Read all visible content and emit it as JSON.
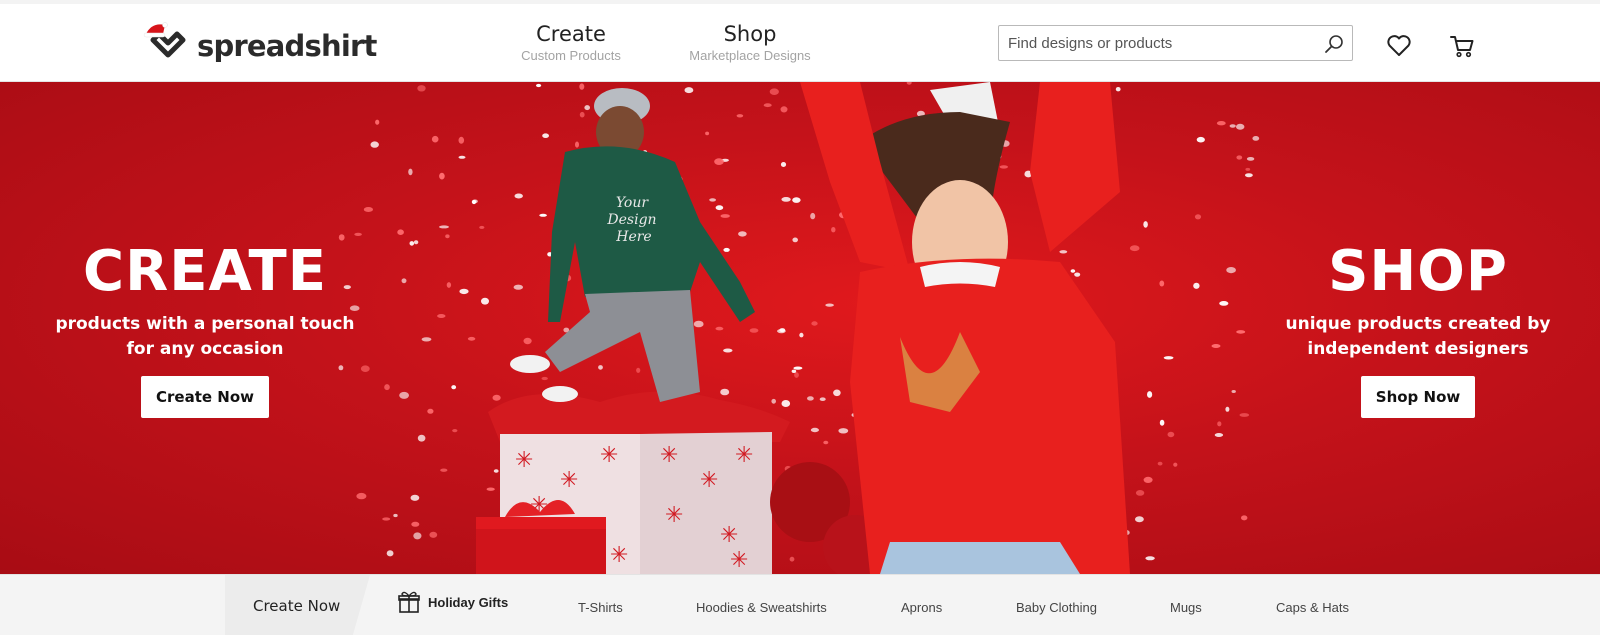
{
  "header": {
    "logo_text": "spreadshirt",
    "nav": [
      {
        "title": "Create",
        "subtitle": "Custom Products"
      },
      {
        "title": "Shop",
        "subtitle": "Marketplace Designs"
      }
    ],
    "search": {
      "placeholder": "Find designs or products",
      "value": ""
    },
    "icons": [
      "search-icon",
      "heart-icon",
      "cart-icon"
    ]
  },
  "hero": {
    "left": {
      "title": "CREATE",
      "subtitle_line1": "products with a personal touch",
      "subtitle_line2": "for any occasion",
      "button": "Create Now"
    },
    "right": {
      "title": "SHOP",
      "subtitle_line1": "unique products created by",
      "subtitle_line2": "independent designers",
      "button": "Shop Now"
    },
    "hoodie_print": "Your Design Here"
  },
  "category_bar": {
    "create_label": "Create Now",
    "items": [
      "Holiday Gifts",
      "T-Shirts",
      "Hoodies & Sweatshirts",
      "Aprons",
      "Baby Clothing",
      "Mugs",
      "Caps & Hats"
    ]
  },
  "colors": {
    "hero_red": "#c4121a",
    "accent_white": "#ffffff",
    "sweater_red": "#e8201e",
    "hoodie_green": "#1e5a45",
    "reindeer_gold": "#d69a4a"
  }
}
